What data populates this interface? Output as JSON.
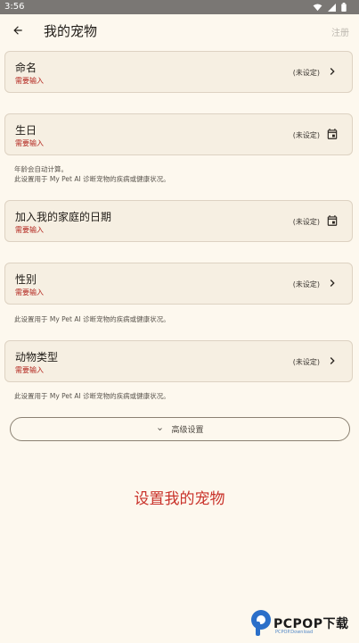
{
  "status_bar": {
    "time": "3:56"
  },
  "app_bar": {
    "title": "我的宠物",
    "register_label": "注册"
  },
  "fields": [
    {
      "label": "命名",
      "required": "需要输入",
      "value": "(未设定)",
      "trailing_icon": "chevron-right-icon"
    },
    {
      "label": "生日",
      "required": "需要输入",
      "value": "(未设定)",
      "trailing_icon": "calendar-icon"
    },
    {
      "label": "加入我的家庭的日期",
      "required": "需要输入",
      "value": "(未设定)",
      "trailing_icon": "calendar-icon"
    },
    {
      "label": "性别",
      "required": "需要输入",
      "value": "(未设定)",
      "trailing_icon": "chevron-right-icon"
    },
    {
      "label": "动物类型",
      "required": "需要输入",
      "value": "(未设定)",
      "trailing_icon": "chevron-right-icon"
    }
  ],
  "helpers": {
    "birthday_line1": "年龄会自动计算。",
    "birthday_line2": "此设置用于 My Pet AI 诊断宠物的疾病或健康状况。",
    "gender": "此设置用于 My Pet AI 诊断宠物的疾病或健康状况。",
    "animal_type": "此设置用于 My Pet AI 诊断宠物的疾病或健康状况。"
  },
  "advanced_settings_label": "高级设置",
  "setup_title": "设置我的宠物",
  "watermark": {
    "text": "PCPOP下载",
    "sub": "PCPOP.Download"
  },
  "colors": {
    "background": "#fdf8ee",
    "card": "#f6efe2",
    "required": "#b3261e",
    "accent_title": "#c9322a"
  }
}
